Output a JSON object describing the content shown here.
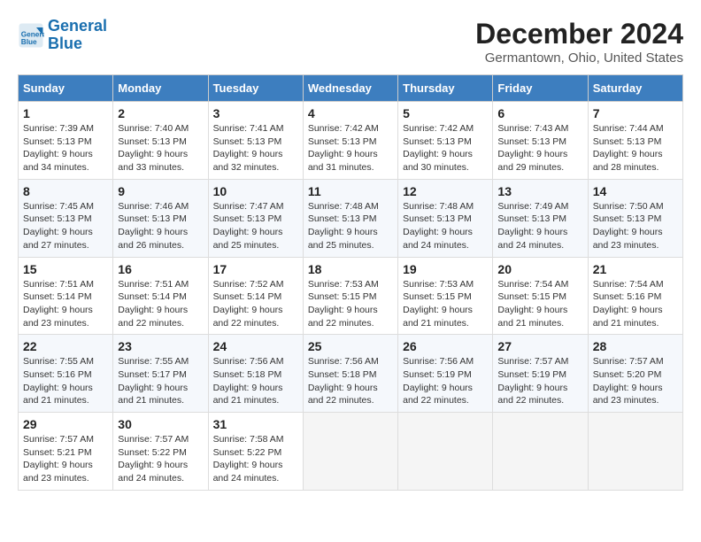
{
  "header": {
    "logo_line1": "General",
    "logo_line2": "Blue",
    "title": "December 2024",
    "subtitle": "Germantown, Ohio, United States"
  },
  "calendar": {
    "columns": [
      "Sunday",
      "Monday",
      "Tuesday",
      "Wednesday",
      "Thursday",
      "Friday",
      "Saturday"
    ],
    "weeks": [
      [
        {
          "num": "1",
          "sunrise": "7:39 AM",
          "sunset": "5:13 PM",
          "daylight": "9 hours and 34 minutes."
        },
        {
          "num": "2",
          "sunrise": "7:40 AM",
          "sunset": "5:13 PM",
          "daylight": "9 hours and 33 minutes."
        },
        {
          "num": "3",
          "sunrise": "7:41 AM",
          "sunset": "5:13 PM",
          "daylight": "9 hours and 32 minutes."
        },
        {
          "num": "4",
          "sunrise": "7:42 AM",
          "sunset": "5:13 PM",
          "daylight": "9 hours and 31 minutes."
        },
        {
          "num": "5",
          "sunrise": "7:42 AM",
          "sunset": "5:13 PM",
          "daylight": "9 hours and 30 minutes."
        },
        {
          "num": "6",
          "sunrise": "7:43 AM",
          "sunset": "5:13 PM",
          "daylight": "9 hours and 29 minutes."
        },
        {
          "num": "7",
          "sunrise": "7:44 AM",
          "sunset": "5:13 PM",
          "daylight": "9 hours and 28 minutes."
        }
      ],
      [
        {
          "num": "8",
          "sunrise": "7:45 AM",
          "sunset": "5:13 PM",
          "daylight": "9 hours and 27 minutes."
        },
        {
          "num": "9",
          "sunrise": "7:46 AM",
          "sunset": "5:13 PM",
          "daylight": "9 hours and 26 minutes."
        },
        {
          "num": "10",
          "sunrise": "7:47 AM",
          "sunset": "5:13 PM",
          "daylight": "9 hours and 25 minutes."
        },
        {
          "num": "11",
          "sunrise": "7:48 AM",
          "sunset": "5:13 PM",
          "daylight": "9 hours and 25 minutes."
        },
        {
          "num": "12",
          "sunrise": "7:48 AM",
          "sunset": "5:13 PM",
          "daylight": "9 hours and 24 minutes."
        },
        {
          "num": "13",
          "sunrise": "7:49 AM",
          "sunset": "5:13 PM",
          "daylight": "9 hours and 24 minutes."
        },
        {
          "num": "14",
          "sunrise": "7:50 AM",
          "sunset": "5:13 PM",
          "daylight": "9 hours and 23 minutes."
        }
      ],
      [
        {
          "num": "15",
          "sunrise": "7:51 AM",
          "sunset": "5:14 PM",
          "daylight": "9 hours and 23 minutes."
        },
        {
          "num": "16",
          "sunrise": "7:51 AM",
          "sunset": "5:14 PM",
          "daylight": "9 hours and 22 minutes."
        },
        {
          "num": "17",
          "sunrise": "7:52 AM",
          "sunset": "5:14 PM",
          "daylight": "9 hours and 22 minutes."
        },
        {
          "num": "18",
          "sunrise": "7:53 AM",
          "sunset": "5:15 PM",
          "daylight": "9 hours and 22 minutes."
        },
        {
          "num": "19",
          "sunrise": "7:53 AM",
          "sunset": "5:15 PM",
          "daylight": "9 hours and 21 minutes."
        },
        {
          "num": "20",
          "sunrise": "7:54 AM",
          "sunset": "5:15 PM",
          "daylight": "9 hours and 21 minutes."
        },
        {
          "num": "21",
          "sunrise": "7:54 AM",
          "sunset": "5:16 PM",
          "daylight": "9 hours and 21 minutes."
        }
      ],
      [
        {
          "num": "22",
          "sunrise": "7:55 AM",
          "sunset": "5:16 PM",
          "daylight": "9 hours and 21 minutes."
        },
        {
          "num": "23",
          "sunrise": "7:55 AM",
          "sunset": "5:17 PM",
          "daylight": "9 hours and 21 minutes."
        },
        {
          "num": "24",
          "sunrise": "7:56 AM",
          "sunset": "5:18 PM",
          "daylight": "9 hours and 21 minutes."
        },
        {
          "num": "25",
          "sunrise": "7:56 AM",
          "sunset": "5:18 PM",
          "daylight": "9 hours and 22 minutes."
        },
        {
          "num": "26",
          "sunrise": "7:56 AM",
          "sunset": "5:19 PM",
          "daylight": "9 hours and 22 minutes."
        },
        {
          "num": "27",
          "sunrise": "7:57 AM",
          "sunset": "5:19 PM",
          "daylight": "9 hours and 22 minutes."
        },
        {
          "num": "28",
          "sunrise": "7:57 AM",
          "sunset": "5:20 PM",
          "daylight": "9 hours and 23 minutes."
        }
      ],
      [
        {
          "num": "29",
          "sunrise": "7:57 AM",
          "sunset": "5:21 PM",
          "daylight": "9 hours and 23 minutes."
        },
        {
          "num": "30",
          "sunrise": "7:57 AM",
          "sunset": "5:22 PM",
          "daylight": "9 hours and 24 minutes."
        },
        {
          "num": "31",
          "sunrise": "7:58 AM",
          "sunset": "5:22 PM",
          "daylight": "9 hours and 24 minutes."
        },
        null,
        null,
        null,
        null
      ]
    ]
  }
}
